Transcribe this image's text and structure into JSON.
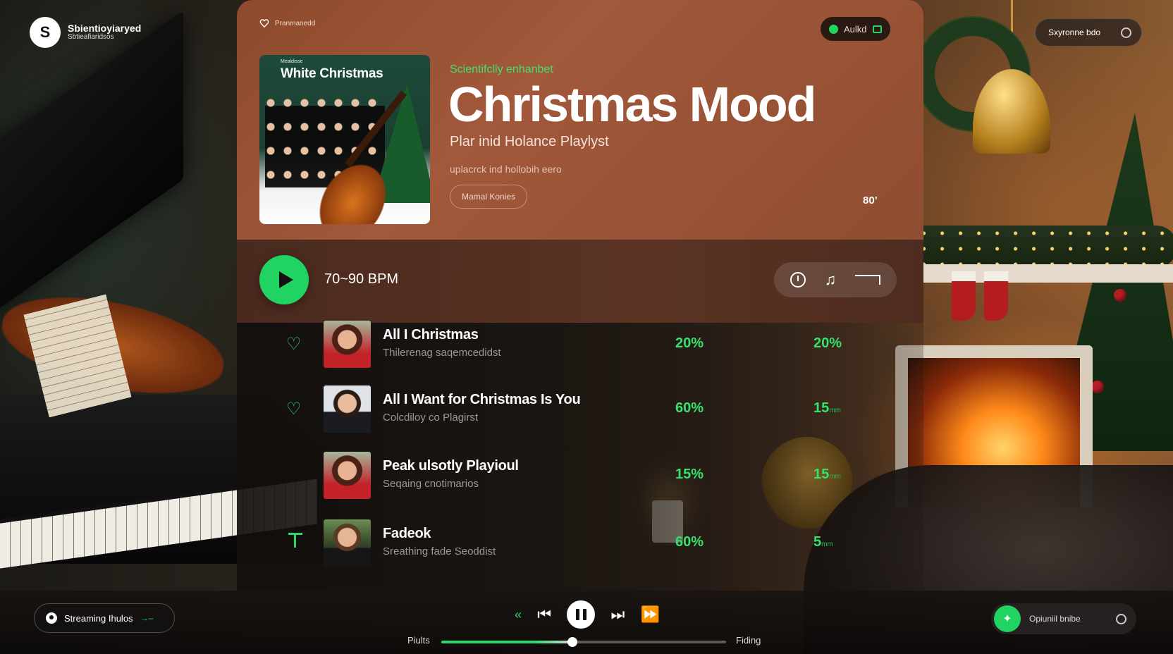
{
  "brand": {
    "name": "Sbientioyiaryed",
    "sub": "Sbtieafiaridsos",
    "logo_glyph": "S"
  },
  "top_right": {
    "label": "Sxyronne bdo"
  },
  "panel": {
    "brand_label": "Pranmanedd",
    "audio_badge": "Aulkd",
    "cover": {
      "tiny": "Mealdisse",
      "title": "White Christmas"
    },
    "tagline": "Scientifclly enhanbet",
    "title": "Christmas Mood",
    "playlist_subtitle": "Plar inid Holance Playlyst",
    "description": "uplacrck ind hollobih eero",
    "chip": "Mamal Konies",
    "eighty": "80’",
    "bpm": "70~90 BPM"
  },
  "tracks": [
    {
      "title": "All I Christmas",
      "subtitle": "Thilerenag saqemcedidst",
      "pct1": "20%",
      "pct2": "20%",
      "pct2_suffix": "",
      "icon": "heart-icon"
    },
    {
      "title": "All I Want for Christmas Is You",
      "subtitle": "Colcdiloy co Plagirst",
      "pct1": "60%",
      "pct2": "15",
      "pct2_suffix": "mm",
      "icon": "heart-icon"
    },
    {
      "title": "Peak ulsotly Playioul",
      "subtitle": "Seqaing cnotimarios",
      "pct1": "15%",
      "pct2": "15",
      "pct2_suffix": "mm",
      "icon": "none"
    },
    {
      "title": "Fadeok",
      "subtitle": "Sreathing fade Seoddist",
      "pct1": "60%",
      "pct2": "5",
      "pct2_suffix": "mm",
      "icon": "pin-icon"
    }
  ],
  "player": {
    "stream_label": "Streaming Ihulos",
    "progress_left": "Piults",
    "progress_right": "Fiding",
    "progress": 0.46,
    "option_label": "Opiuniil bnibe"
  },
  "colors": {
    "accent": "#21d462",
    "panel_top": "#9c5436"
  }
}
